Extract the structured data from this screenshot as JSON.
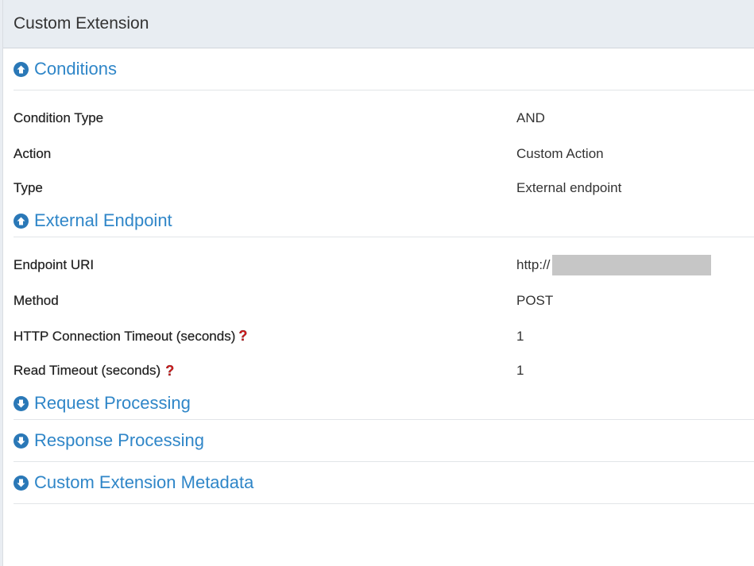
{
  "panel": {
    "title": "Custom Extension"
  },
  "sections": {
    "conditions": {
      "title": "Conditions",
      "icon": "circle-arrow-up-icon",
      "rows": [
        {
          "label": "Condition Type",
          "value": "AND"
        },
        {
          "label": "Action",
          "value": "Custom Action"
        },
        {
          "label": "Type",
          "value": "External endpoint"
        }
      ]
    },
    "external_endpoint": {
      "title": "External Endpoint",
      "icon": "circle-arrow-up-icon",
      "rows": [
        {
          "label": "Endpoint URI",
          "value": "http://"
        },
        {
          "label": "Method",
          "value": "POST"
        },
        {
          "label": "HTTP Connection Timeout (seconds)",
          "value": "1",
          "help": "?"
        },
        {
          "label": "Read Timeout (seconds)",
          "value": "1",
          "help": "?"
        }
      ]
    },
    "request_processing": {
      "title": "Request Processing",
      "icon": "circle-arrow-down-icon"
    },
    "response_processing": {
      "title": "Response Processing",
      "icon": "circle-arrow-down-icon"
    },
    "metadata": {
      "title": "Custom Extension Metadata",
      "icon": "circle-arrow-down-icon"
    }
  },
  "colors": {
    "accent": "#2f86c8",
    "icon": "#2a78b7",
    "help": "#d0191b",
    "header_bg": "#e8edf2"
  }
}
